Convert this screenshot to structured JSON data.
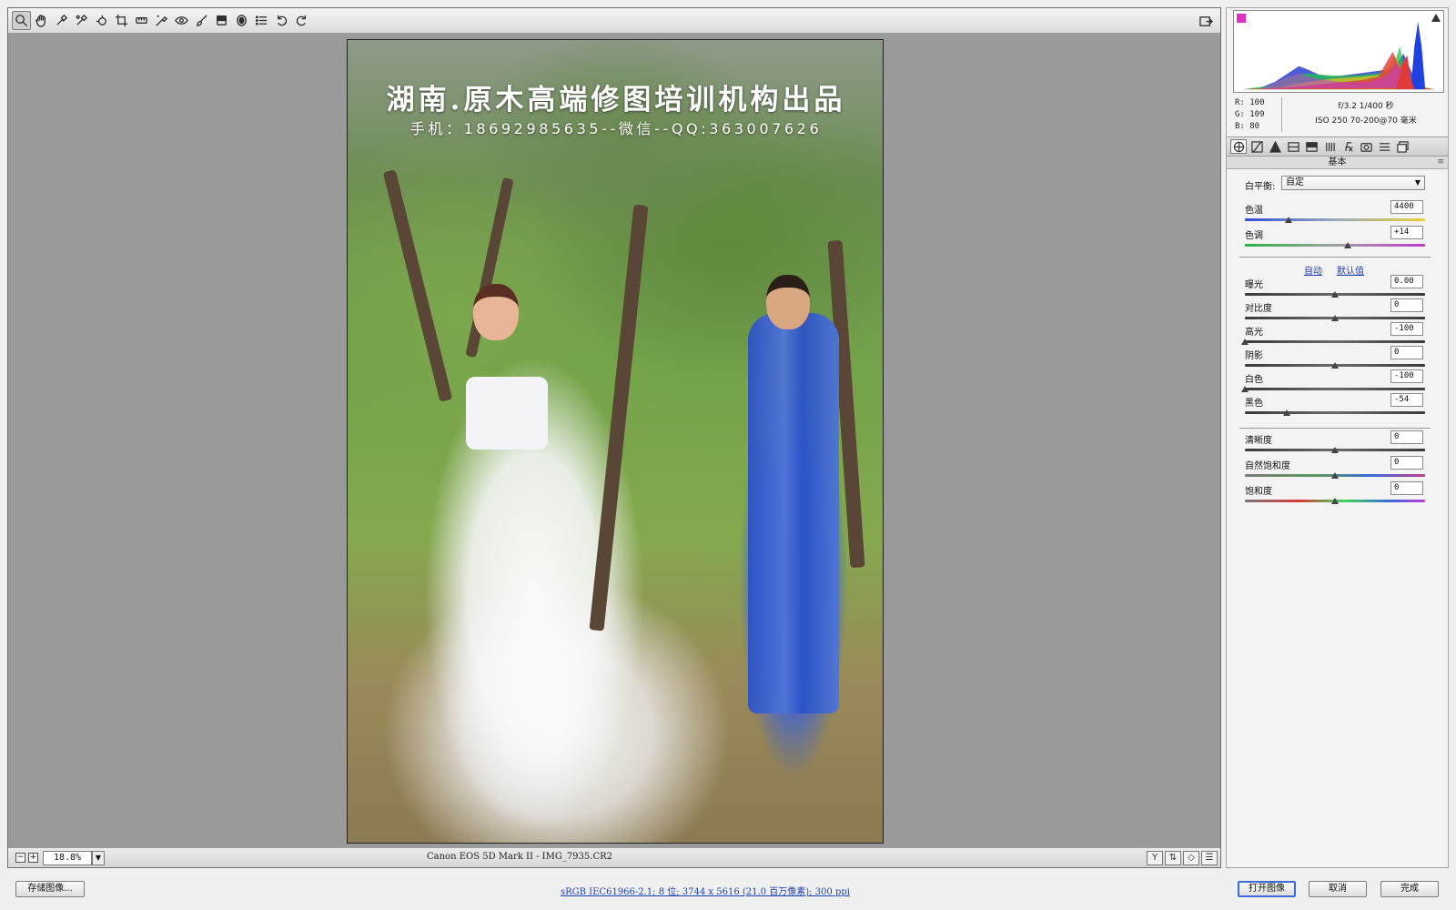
{
  "toolbar": {
    "tools": [
      "zoom-tool",
      "hand-tool",
      "white-balance-tool",
      "color-sampler-tool",
      "targeted-adjustment-tool",
      "crop-tool",
      "straighten-tool",
      "spot-removal-tool",
      "red-eye-tool",
      "adjustment-brush-tool",
      "graduated-filter-tool",
      "radial-filter-tool",
      "preferences-tool",
      "rotate-ccw-tool",
      "rotate-cw-tool"
    ]
  },
  "photo": {
    "watermark_title": "湖南.原木高端修图培训机构出品",
    "watermark_sub": "手机：18692985635--微信--QQ:363007626"
  },
  "status": {
    "zoom": "18.8%",
    "file_info": "Canon EOS 5D Mark II -  IMG_7935.CR2"
  },
  "histogram": {
    "r_label": "R:",
    "r": "100",
    "g_label": "G:",
    "g": "109",
    "b_label": "B:",
    "b": "80",
    "aperture_shutter": "f/3.2  1/400 秒",
    "iso_lens": "ISO 250  70-200@70 毫米"
  },
  "panel": {
    "title": "基本",
    "wb_label": "白平衡:",
    "wb_value": "自定",
    "auto_link": "自动",
    "default_link": "默认值",
    "sliders": [
      {
        "label": "色温",
        "value": "4400",
        "pos": 0.24
      },
      {
        "label": "色调",
        "value": "+14",
        "pos": 0.57
      },
      {
        "label": "曝光",
        "value": "0.00",
        "pos": 0.5
      },
      {
        "label": "对比度",
        "value": "0",
        "pos": 0.5
      },
      {
        "label": "高光",
        "value": "-100",
        "pos": 0.0
      },
      {
        "label": "阴影",
        "value": "0",
        "pos": 0.5
      },
      {
        "label": "白色",
        "value": "-100",
        "pos": 0.0
      },
      {
        "label": "黑色",
        "value": "-54",
        "pos": 0.23
      },
      {
        "label": "清晰度",
        "value": "0",
        "pos": 0.5
      },
      {
        "label": "自然饱和度",
        "value": "0",
        "pos": 0.5
      },
      {
        "label": "饱和度",
        "value": "0",
        "pos": 0.5
      }
    ]
  },
  "bottom": {
    "save_label": "存储图像...",
    "workflow": "sRGB IEC61966-2.1; 8 位; 3744 x 5616 (21.0 百万像素); 300 ppi",
    "open_label": "打开图像",
    "cancel_label": "取消",
    "done_label": "完成"
  },
  "colors": {
    "accent": "#3a6ed6",
    "link": "#1c3fb5",
    "workspace_bg": "#9a9a9a"
  }
}
